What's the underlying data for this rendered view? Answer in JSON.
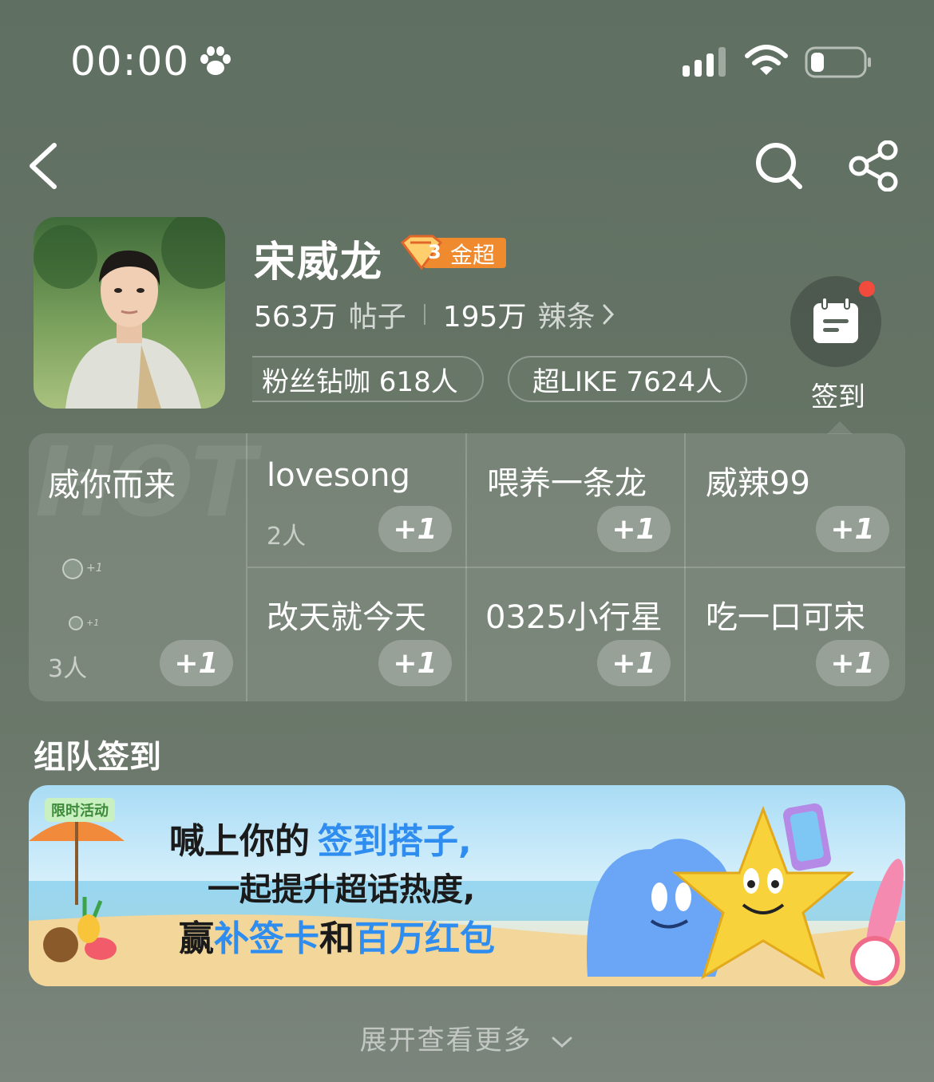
{
  "status_bar": {
    "time": "00:00",
    "icons": [
      "paw-icon",
      "signal-icon",
      "wifi-icon",
      "battery-icon"
    ]
  },
  "nav": {
    "icons": [
      "back-icon",
      "search-icon",
      "share-icon"
    ]
  },
  "profile": {
    "name": "宋威龙",
    "badge_label": "金超",
    "badge_level": "3",
    "posts_count": "563万",
    "posts_label": "帖子",
    "spicy_count": "195万",
    "spicy_label": "辣条",
    "fans_pill": "粉丝钻咖 618人",
    "like_pill": "超LIKE 7624人",
    "checkin_label": "签到"
  },
  "groups": {
    "hot_watermark": "HOT",
    "featured": {
      "title": "威你而来",
      "count": "3人",
      "mini_plus": "+1",
      "action": "+1"
    },
    "cells": [
      {
        "title": "lovesong",
        "count": "2人",
        "action": "+1"
      },
      {
        "title": "喂养一条龙",
        "count": "",
        "action": "+1"
      },
      {
        "title": "威辣99",
        "count": "",
        "action": "+1"
      },
      {
        "title": "改天就今天",
        "count": "",
        "action": "+1"
      },
      {
        "title": "0325小行星",
        "count": "",
        "action": "+1"
      },
      {
        "title": "吃一口可宋",
        "count": "",
        "action": "+1"
      }
    ]
  },
  "team_checkin": {
    "title": "组队签到"
  },
  "banner": {
    "tag": "限时活动",
    "line1_a": "喊上你的",
    "line1_b": "签到搭子,",
    "line2": "一起提升超话热度,",
    "line3_a": "赢",
    "line3_b": "补签卡",
    "line3_c": "和",
    "line3_d": "百万红包"
  },
  "footer": {
    "expand_label": "展开查看更多"
  },
  "colors": {
    "accent_orange": "#f08a2e",
    "notification_red": "#f24a3c",
    "banner_blue": "#2f8df0"
  }
}
